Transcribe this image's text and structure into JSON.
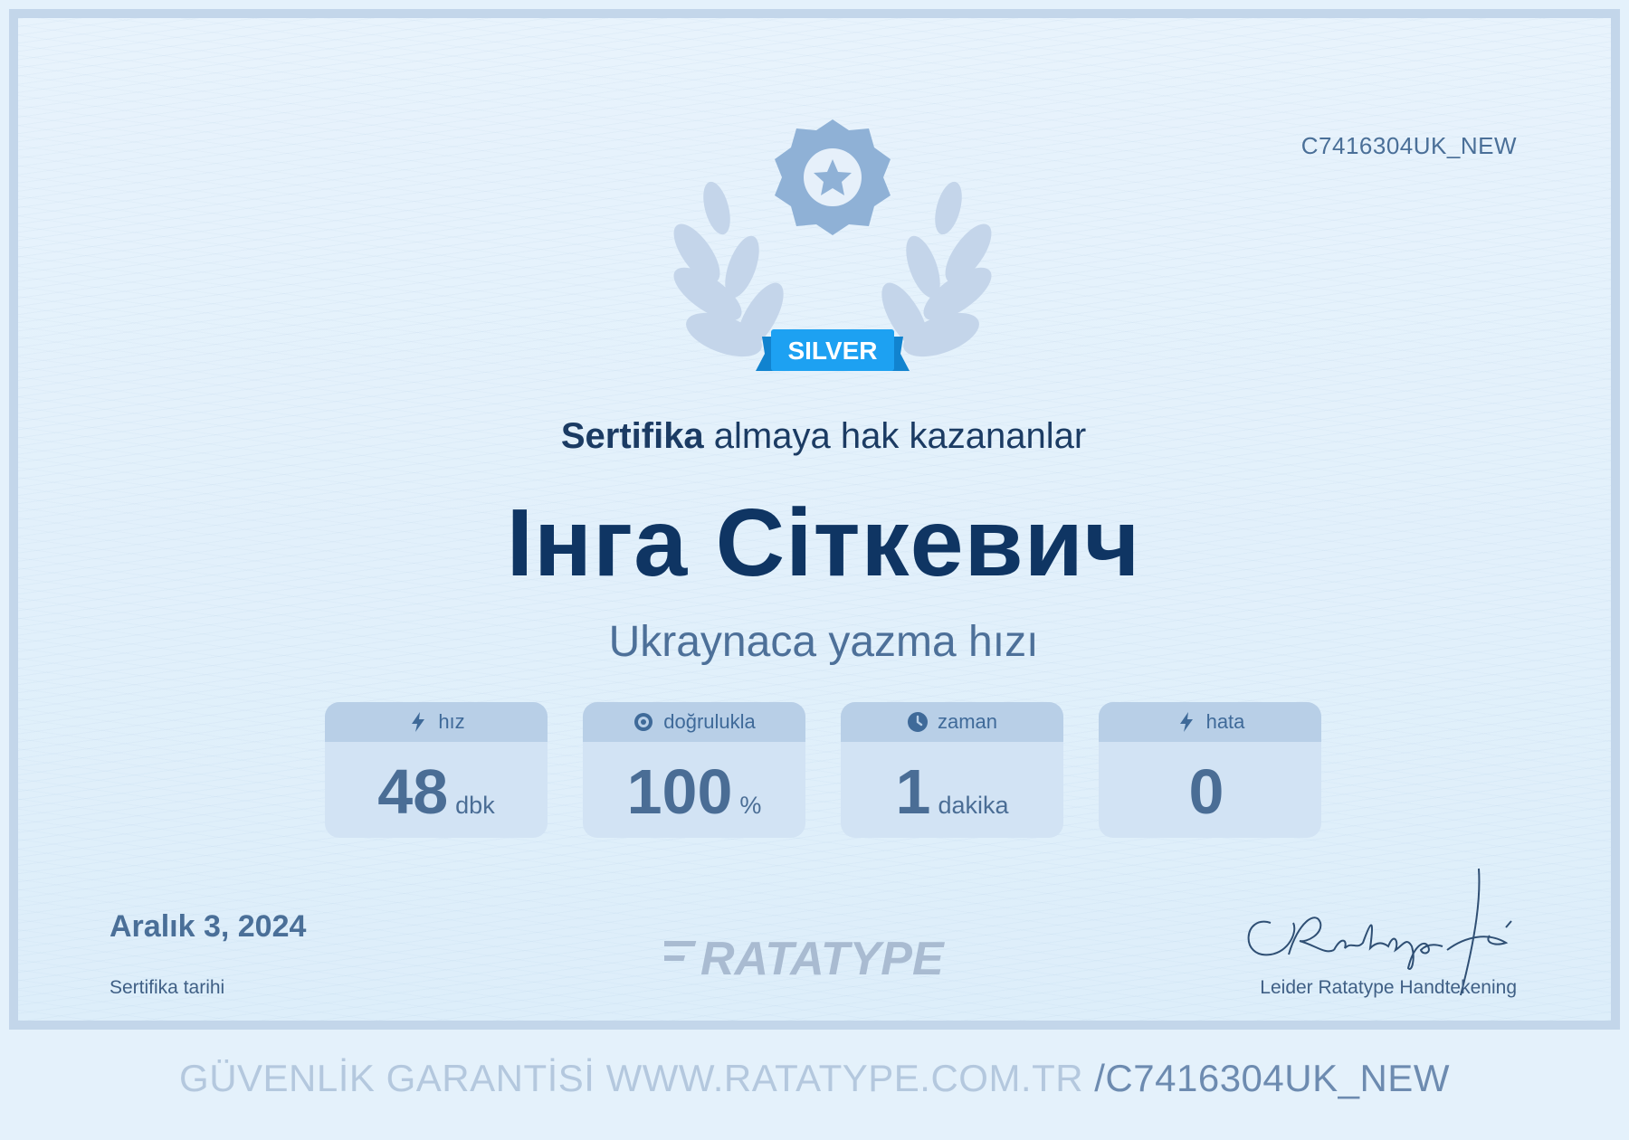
{
  "certificate": {
    "id": "C7416304UK_NEW",
    "badge": "SILVER",
    "heading_bold": "Sertifika",
    "heading_rest": " almaya hak kazananlar",
    "recipient_name": "Інга Сіткевич",
    "subtitle": "Ukraynaca yazma hızı",
    "stats": [
      {
        "label": "hız",
        "value": "48",
        "unit": "dbk",
        "icon": "lightning-icon"
      },
      {
        "label": "doğrulukla",
        "value": "100",
        "unit": "%",
        "icon": "target-icon"
      },
      {
        "label": "zaman",
        "value": "1",
        "unit": "dakika",
        "icon": "clock-icon"
      },
      {
        "label": "hata",
        "value": "0",
        "unit": "",
        "icon": "lightning-icon"
      }
    ],
    "date": "Aralık 3, 2024",
    "date_label": "Sertifika tarihi",
    "logo_text": "RATATYPE",
    "signature_label": "Leider Ratatype Handtekening"
  },
  "footer": {
    "prefix": "GÜVENLİK GARANTİSİ WWW.RATATYPE.COM.TR",
    "suffix": "/C7416304UK_NEW"
  },
  "colors": {
    "page_bg": "#e4f1fb",
    "frame": "#c3d6ea",
    "name": "#0f3563",
    "badge_ribbon": "#1da1f2",
    "badge_seal": "#8fb1d6"
  }
}
